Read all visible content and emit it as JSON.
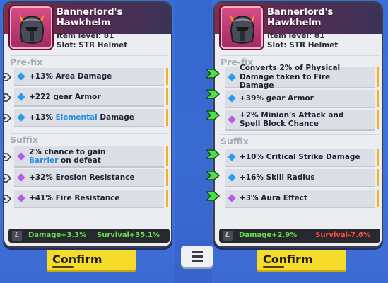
{
  "left_card": {
    "title": "Bannerlord's Hawkhelm",
    "item_level": "Item level: 81",
    "slot": "Slot: STR Helmet",
    "prefix_label": "Pre-fix",
    "prefixes": [
      {
        "pre": "+13% Area Damage",
        "hl": "",
        "post": ""
      },
      {
        "pre": "+222 gear Armor",
        "hl": "",
        "post": ""
      },
      {
        "pre": "+13% ",
        "hl": "Elemental",
        "post": " Damage"
      }
    ],
    "suffix_label": "Suffix",
    "suffixes": [
      {
        "pre": "2% chance to gain ",
        "hl": "Barrier",
        "post": " on defeat"
      },
      {
        "pre": "+32% Erosion Resistance",
        "hl": "",
        "post": ""
      },
      {
        "pre": "+41% Fire Resistance",
        "hl": "",
        "post": ""
      }
    ],
    "footer_mark": "L",
    "damage": "Damage+3.3%",
    "survival": "Survival+35.1%"
  },
  "right_card": {
    "title": "Bannerlord's Hawkhelm",
    "item_level": "Item level: 81",
    "slot": "Slot: STR Helmet",
    "prefix_label": "Pre-fix",
    "prefixes": [
      {
        "pre": "Converts 2% of Physical Damage taken to Fire Damage",
        "hl": "",
        "post": ""
      },
      {
        "pre": "+39% gear Armor",
        "hl": "",
        "post": ""
      },
      {
        "pre": "+2% Minion's Attack and Spell Block Chance",
        "hl": "",
        "post": ""
      }
    ],
    "suffix_label": "Suffix",
    "suffixes": [
      {
        "pre": "+10% Critical Strike Damage",
        "hl": "",
        "post": ""
      },
      {
        "pre": "+16% Skill Radius",
        "hl": "",
        "post": ""
      },
      {
        "pre": "+3% Aura Effect",
        "hl": "",
        "post": ""
      }
    ],
    "footer_mark": "L",
    "damage": "Damage+2.9%",
    "survival": "Survival-7.6%"
  },
  "buttons": {
    "confirm_left": "Confirm",
    "confirm_right": "Confirm"
  },
  "colors": {
    "background": "#3f74dc",
    "positive": "#66e04a",
    "negative": "#ff4a3a",
    "highlight": "#2a8fe0",
    "confirm": "#f5dc2a",
    "affix_bar": "#f3b21f"
  },
  "icons": {
    "item": "helmet-icon",
    "prefix_bullet": "blue-diamond-icon",
    "suffix_bullet": "purple-diamond-icon",
    "left_arrow": "white-arrow-icon",
    "right_arrow": "green-arrow-icon",
    "menu": "hamburger-menu-icon"
  }
}
